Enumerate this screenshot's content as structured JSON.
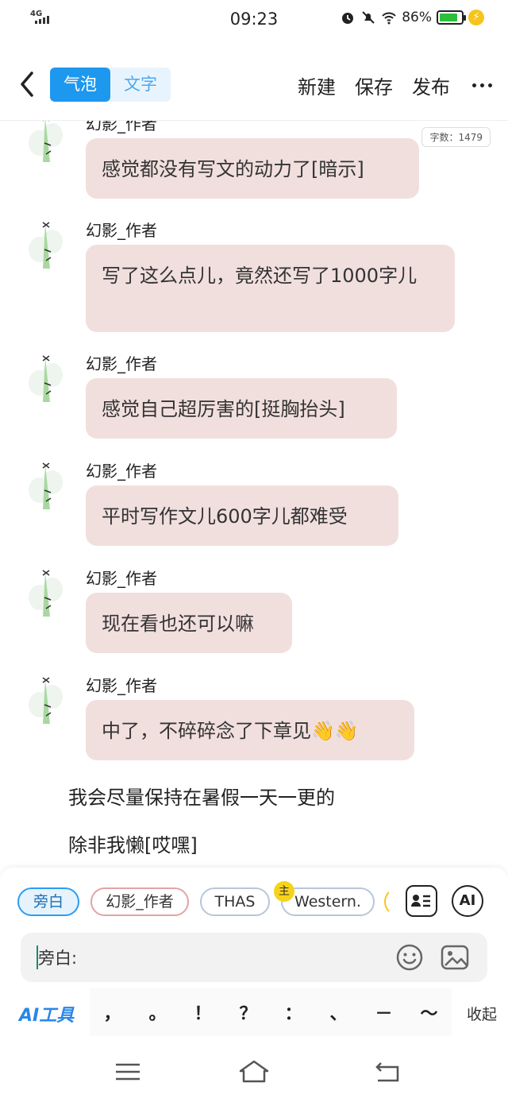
{
  "status_bar": {
    "network": "4G",
    "time": "09:23",
    "battery": "86%",
    "battery_level": 0.86
  },
  "header": {
    "tabs": [
      {
        "label": "气泡",
        "active": true
      },
      {
        "label": "文字",
        "active": false
      }
    ],
    "actions": {
      "new": "新建",
      "save": "保存",
      "publish": "发布"
    }
  },
  "word_count": "字数：1479",
  "messages": [
    {
      "name": "幻影_作者",
      "text": "感觉都没有写文的动力了[暗示]"
    },
    {
      "name": "幻影_作者",
      "text": "写了这么点儿，竟然还写了1000字儿"
    },
    {
      "name": "幻影_作者",
      "text": "感觉自己超厉害的[挺胸抬头]"
    },
    {
      "name": "幻影_作者",
      "text": "平时写作文儿600字儿都难受"
    },
    {
      "name": "幻影_作者",
      "text": "现在看也还可以嘛"
    },
    {
      "name": "幻影_作者",
      "text": "中了，不碎碎念了下章见👋👋"
    }
  ],
  "narrations": [
    "我会尽量保持在暑假一天一更的",
    "除非我懒[哎嘿]"
  ],
  "panel": {
    "roles": [
      "旁白",
      "幻影_作者",
      "THAS",
      "Western."
    ],
    "host_badge": "主",
    "ai_label": "AI",
    "input_value": "旁白:",
    "ai_tools": "AI工具",
    "punctuation": [
      "，",
      "。",
      "！",
      "？",
      "：",
      "、",
      "－",
      "～"
    ],
    "collapse": "收起"
  },
  "colors": {
    "accent": "#1e98ee",
    "bubble": "#f1dfde",
    "ai_tools": "#2a86e8",
    "host_badge": "#f6d31b"
  }
}
